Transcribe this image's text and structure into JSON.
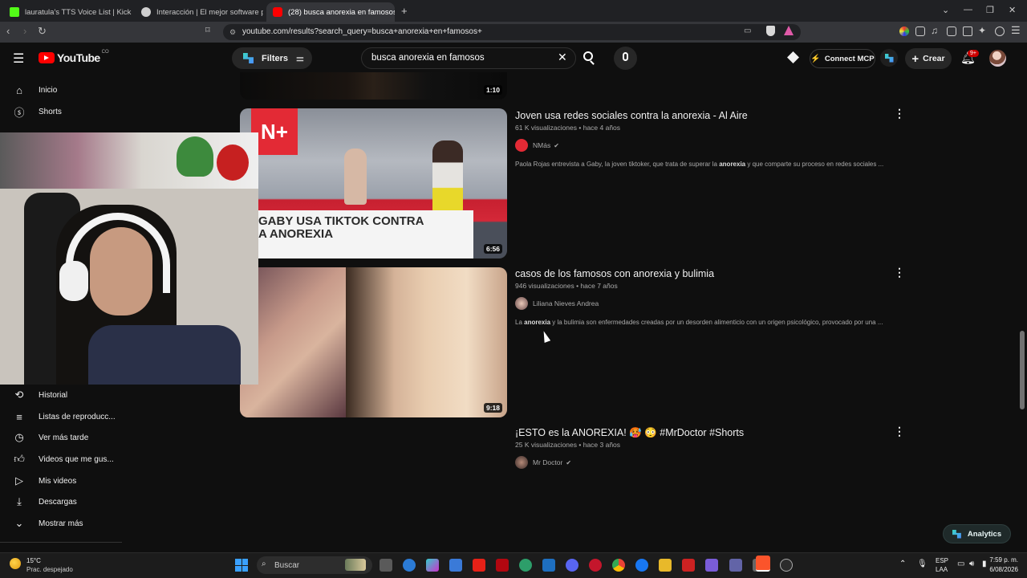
{
  "browser": {
    "tabs": [
      {
        "title": "lauratula's TTS Voice List | KickBot",
        "color": "#53fc18"
      },
      {
        "title": "Interacción | El mejor software para p",
        "color": "#cfcfcf"
      },
      {
        "title": "(28) busca anorexia en famosos",
        "color": "#ff0000",
        "close": "✕"
      }
    ],
    "new_tab": "+",
    "url": "youtube.com/results?search_query=busca+anorexia+en+famosos+"
  },
  "header": {
    "logo_text": "YouTube",
    "logo_sup": "CO",
    "filters_label": "Filters",
    "search_value": "busca anorexia en famosos",
    "connect_label": "Connect MCP",
    "create_label": "Crear",
    "notif_badge": "9+"
  },
  "sidebar": {
    "top": [
      {
        "label": "Inicio",
        "icon": "home-icon"
      },
      {
        "label": "Shorts",
        "icon": "shorts-icon"
      }
    ],
    "bottom": [
      {
        "label": "Historial",
        "icon": "history-icon"
      },
      {
        "label": "Listas de reproducc...",
        "icon": "playlist-icon"
      },
      {
        "label": "Ver más tarde",
        "icon": "clock-icon"
      },
      {
        "label": "Videos que me gus...",
        "icon": "thumbs-up-icon"
      },
      {
        "label": "Mis videos",
        "icon": "video-icon"
      },
      {
        "label": "Descargas",
        "icon": "download-icon"
      },
      {
        "label": "Mostrar más",
        "icon": "chevron-down-icon"
      }
    ]
  },
  "results": {
    "prev_duration": "1:10",
    "videos": [
      {
        "title": "Joven usa redes sociales contra la anorexia - Al Aire",
        "meta": "61 K visualizaciones • hace 4 años",
        "channel": "NMás",
        "verified": true,
        "desc_before": "Paola Rojas entrevista a Gaby, la joven tiktoker, que trata de superar la ",
        "desc_bold": "anorexia",
        "desc_after": " y que comparte su proceso en redes sociales ...",
        "duration": "6:56",
        "thumb_caption_line1": "GABY USA TIKTOK CONTRA",
        "thumb_caption_line2": "A ANOREXIA",
        "thumb_logo": "N+"
      },
      {
        "title": "casos de los famosos con anorexia y bulimia",
        "meta": "946 visualizaciones • hace 7 años",
        "channel": "Liliana Nieves Andrea",
        "verified": false,
        "desc_before": "La ",
        "desc_bold": "anorexia",
        "desc_after": " y la bulimia son enfermedades creadas por un desorden alimenticio con un origen psicológico, provocado por una ...",
        "duration": "9:18"
      },
      {
        "title": "¡ESTO es la ANOREXIA! 🥵 😳 #MrDoctor #Shorts",
        "meta": "25 K visualizaciones • hace 3 años",
        "channel": "Mr Doctor",
        "verified": true
      }
    ]
  },
  "analytics_label": "Analytics",
  "taskbar": {
    "weather_temp": "15°C",
    "weather_desc": "Prac. despejado",
    "search_placeholder": "Buscar",
    "lang_line1": "ESP",
    "lang_line2": "LAA",
    "time": "7:59 p. m.",
    "date": "6/08/2026"
  },
  "colors": {
    "bg": "#0f0f0f",
    "youtube_red": "#ff0000",
    "kick_green": "#53fc18"
  }
}
